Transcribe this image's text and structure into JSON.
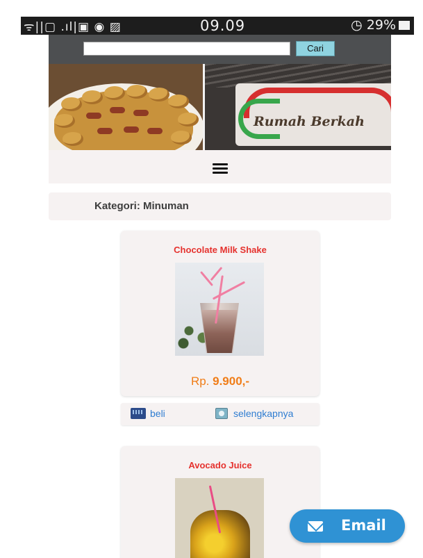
{
  "status_bar": {
    "left_indicators": "ᯤ||▢ .ıl|▣ ◉ ▨",
    "time": "09.09",
    "battery": "29%"
  },
  "search": {
    "value": "",
    "placeholder": "",
    "button_label": "Cari"
  },
  "banner": {
    "sign_text": "Rumah Berkah"
  },
  "category": {
    "title": "Kategori: Minuman"
  },
  "products": [
    {
      "name": "Chocolate Milk Shake",
      "price_prefix": "Rp. ",
      "price_value": "9.900,-",
      "image_icon": "milkshake-image"
    },
    {
      "name": "Avocado Juice",
      "image_icon": "avocado-juice-image"
    }
  ],
  "actions": {
    "buy_label": "beli",
    "detail_label": "selengkapnya"
  },
  "email_button": {
    "label": "Email",
    "icon": "mail-icon"
  },
  "colors": {
    "product_name": "#e5312d",
    "price": "#f07d17",
    "link": "#2f7dd1",
    "email_button": "#2f92d4",
    "search_bar": "#4d4f51",
    "card_bg": "#f6f2f2"
  }
}
